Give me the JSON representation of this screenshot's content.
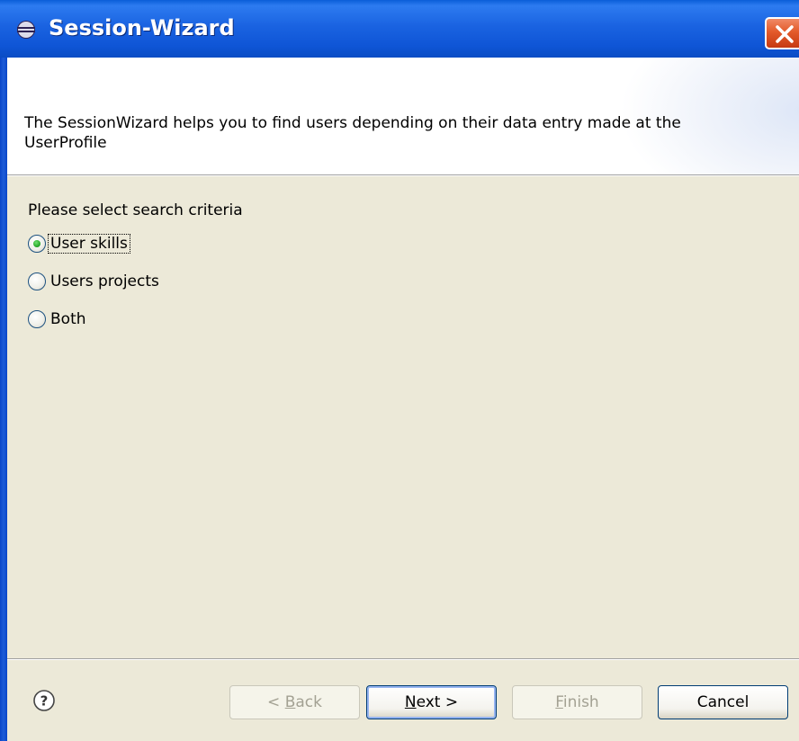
{
  "window": {
    "title": "Session-Wizard"
  },
  "header": {
    "description": "The SessionWizard helps you to find users depending on their data entry made at the UserProfile"
  },
  "content": {
    "prompt": "Please select search criteria",
    "options": [
      {
        "label": "User skills",
        "checked": true,
        "focused": true
      },
      {
        "label": "Users projects",
        "checked": false
      },
      {
        "label": "Both",
        "checked": false
      }
    ]
  },
  "footer": {
    "back": {
      "pre": "< ",
      "mnemonic": "B",
      "post": "ack",
      "enabled": false
    },
    "next": {
      "pre": "",
      "mnemonic": "N",
      "post": "ext >",
      "enabled": true
    },
    "finish": {
      "pre": "",
      "mnemonic": "F",
      "post": "inish",
      "enabled": false
    },
    "cancel": {
      "label": "Cancel",
      "enabled": true
    }
  },
  "icons": {
    "window": "eclipse-icon",
    "close": "close-icon",
    "help": "help-icon"
  },
  "colors": {
    "titlebar": "#0f55d6",
    "close_button": "#e35a2a",
    "dialog_bg": "#ece9d8",
    "radio_dot": "#21a121"
  }
}
